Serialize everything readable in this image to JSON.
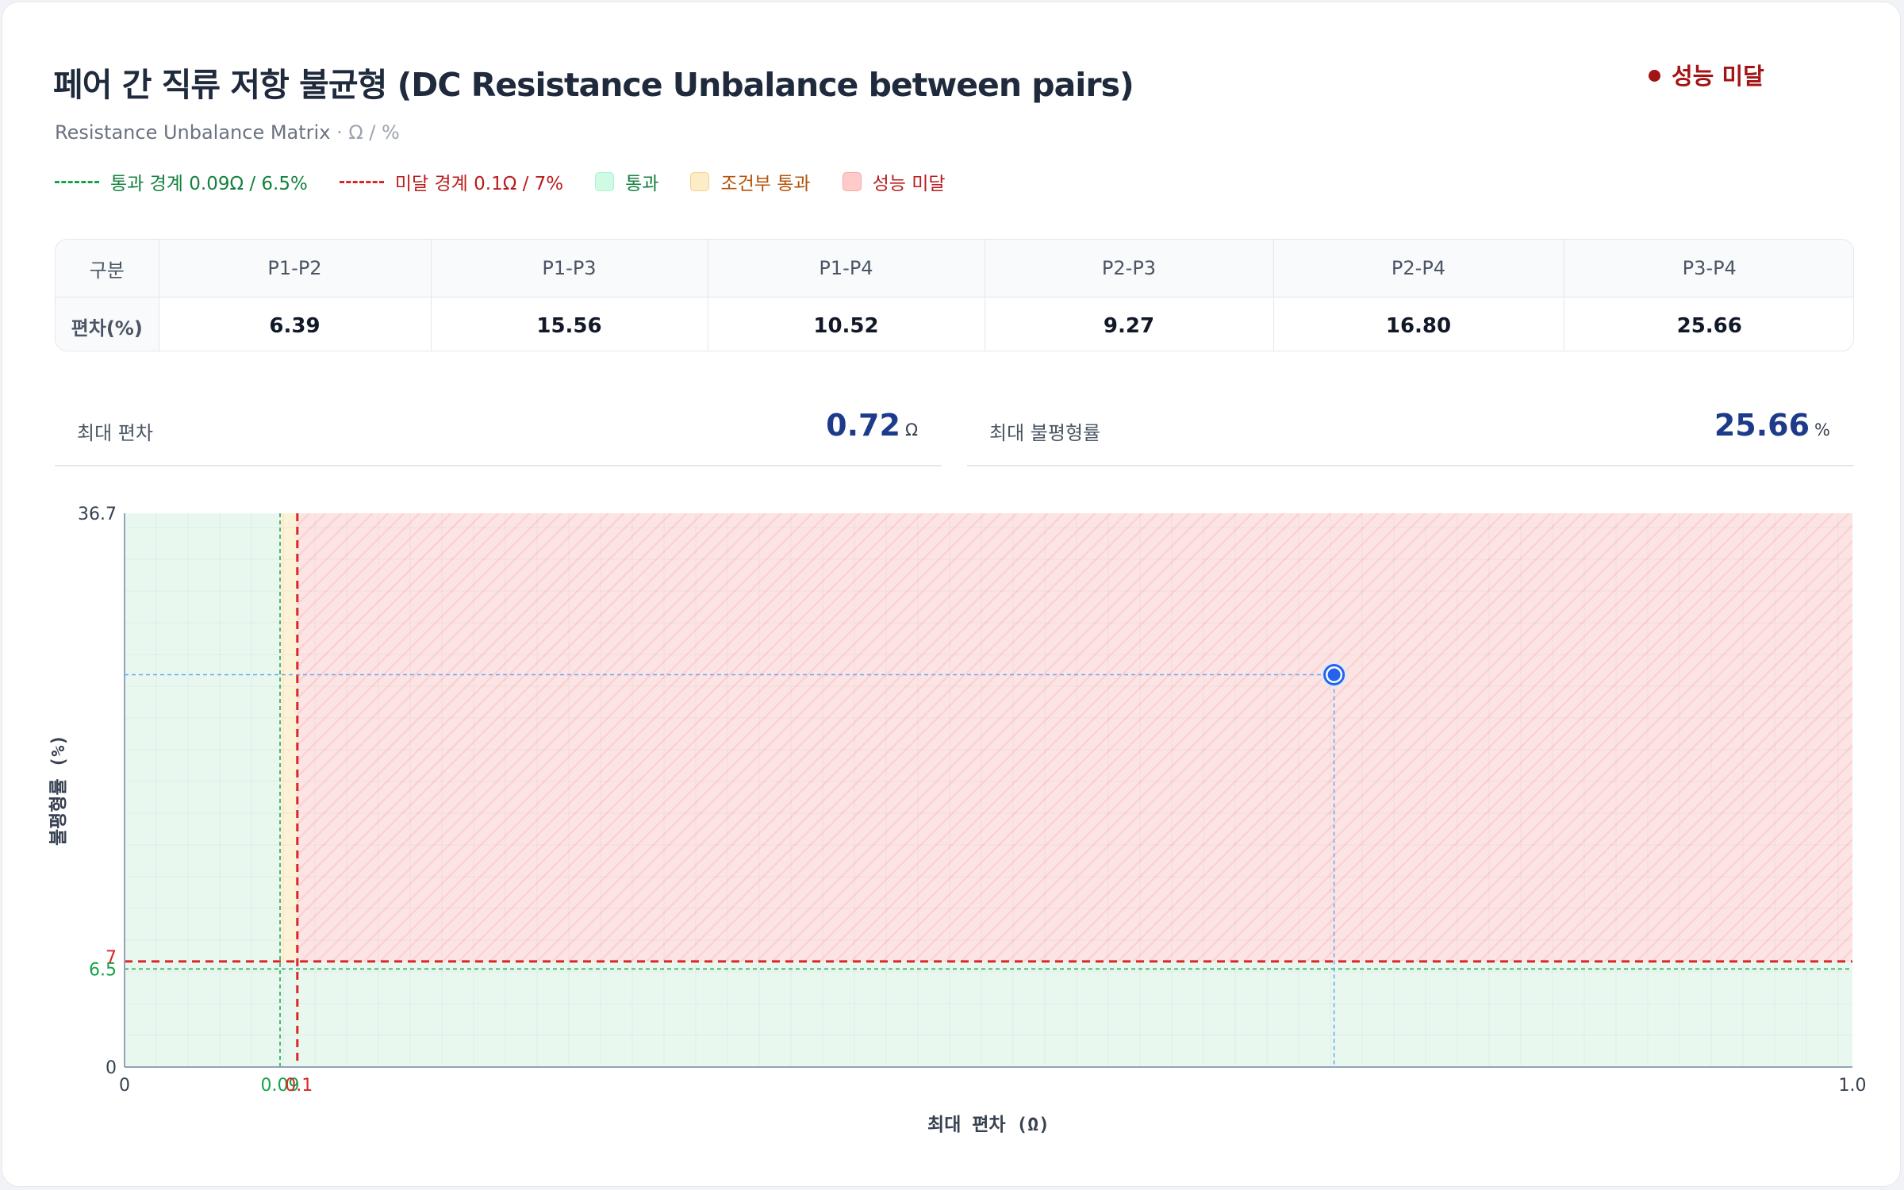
{
  "header": {
    "title": "페어 간 직류 저항 불균형 (DC Resistance Unbalance between pairs)",
    "subtitle": "Resistance Unbalance Matrix",
    "subtitle_unit": "· Ω / %",
    "status": "성능 미달"
  },
  "legend": {
    "pass_line": "통과 경계 0.09Ω / 6.5%",
    "fail_line": "미달 경계 0.1Ω / 7%",
    "pass_zone": "통과",
    "cond_zone": "조건부 통과",
    "fail_zone": "성능 미달"
  },
  "matrix": {
    "row_header": "구분",
    "row_label": "편차(%)",
    "columns": [
      "P1-P2",
      "P1-P3",
      "P1-P4",
      "P2-P3",
      "P2-P4",
      "P3-P4"
    ],
    "values": [
      "6.39",
      "15.56",
      "10.52",
      "9.27",
      "16.80",
      "25.66"
    ]
  },
  "kpis": {
    "max_dev_label": "최대 편차",
    "max_dev_value": "0.72",
    "max_dev_unit": "Ω",
    "max_unb_label": "최대 불평형률",
    "max_unb_value": "25.66",
    "max_unb_unit": "%"
  },
  "chart_data": {
    "type": "scatter",
    "xlabel": "최대 편차 (Ω)",
    "ylabel": "불평형률 (%)",
    "xlim": [
      0,
      1.0
    ],
    "ylim": [
      0,
      36.7
    ],
    "x_ticks": [
      "0",
      "1.0"
    ],
    "y_ticks": [
      "0",
      "36.7"
    ],
    "pass_threshold": {
      "x": 0.09,
      "y": 6.5,
      "x_label": "0.09",
      "y_label": "6.5"
    },
    "fail_threshold": {
      "x": 0.1,
      "y": 7,
      "x_label": "0.1",
      "y_label": "7"
    },
    "points": [
      {
        "x": 0.7,
        "y": 26.0
      }
    ],
    "colors": {
      "pass": "#16a34a",
      "fail": "#dc2626",
      "point": "#2563eb"
    }
  }
}
